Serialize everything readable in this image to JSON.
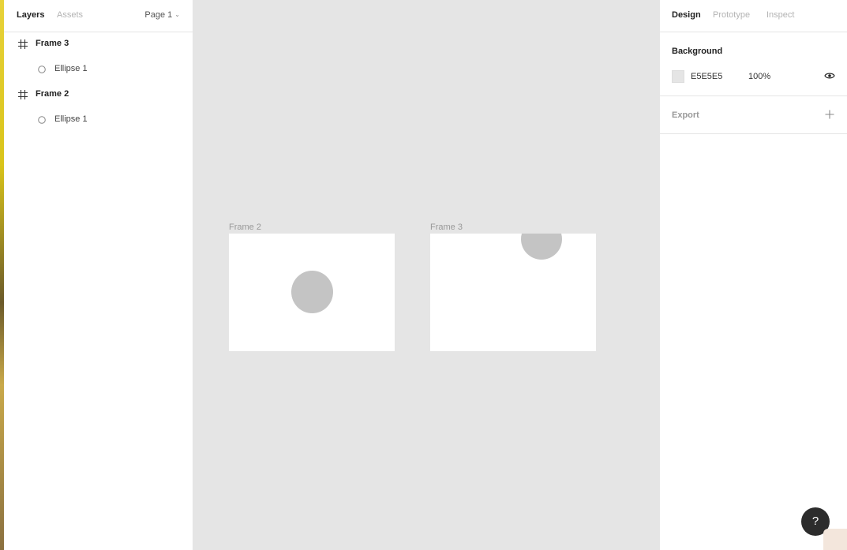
{
  "left_panel": {
    "tabs": {
      "layers": "Layers",
      "assets": "Assets"
    },
    "page_select": {
      "label": "Page 1"
    },
    "layers": [
      {
        "name": "Frame 3",
        "type": "frame-icon"
      },
      {
        "name": "Ellipse 1",
        "type": "ellipse-icon"
      },
      {
        "name": "Frame 2",
        "type": "frame-icon"
      },
      {
        "name": "Ellipse 1",
        "type": "ellipse-icon"
      }
    ]
  },
  "canvas": {
    "background": "#E5E5E5",
    "frames": [
      {
        "label": "Frame 2",
        "fill": "#FFFFFF",
        "ellipse_fill": "#C4C4C4"
      },
      {
        "label": "Frame 3",
        "fill": "#FFFFFF",
        "ellipse_fill": "#C4C4C4"
      }
    ]
  },
  "right_panel": {
    "tabs": {
      "design": "Design",
      "prototype": "Prototype",
      "inspect": "Inspect"
    },
    "background": {
      "title": "Background",
      "hex": "E5E5E5",
      "opacity": "100%",
      "visibility_icon": "eye-icon"
    },
    "export": {
      "title": "Export",
      "add_icon": "plus-icon"
    }
  },
  "help": {
    "label": "?"
  }
}
